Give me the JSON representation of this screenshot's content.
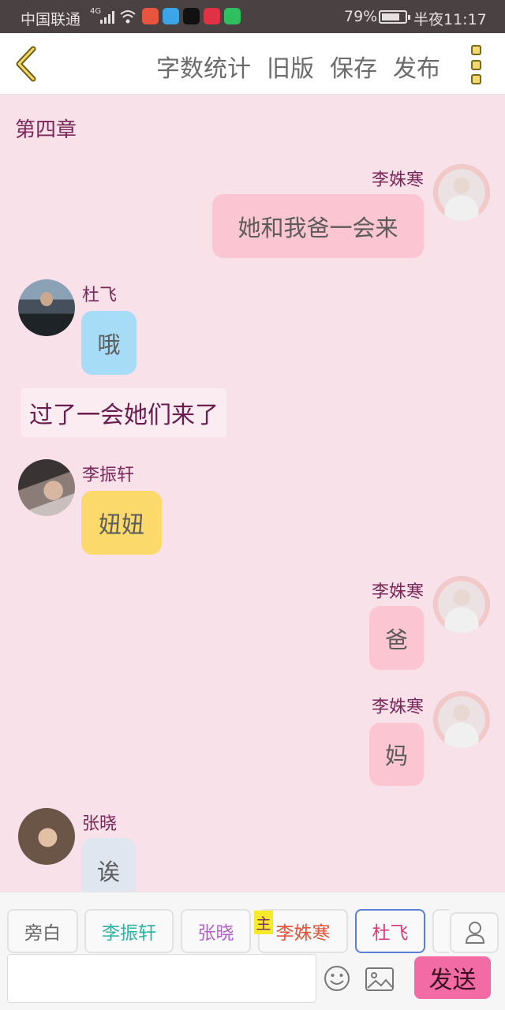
{
  "status_bar": {
    "carrier": "中国联通",
    "network_badge": "4G",
    "battery_percent": "79%",
    "time": "半夜11:17",
    "app_icon_colors": [
      "#e8553f",
      "#3ba5e8",
      "#111111",
      "#e03245",
      "#2fbf5f"
    ]
  },
  "toolbar": {
    "back_icon": "chevron-left-icon",
    "word_count": "字数统计",
    "old_version": "旧版",
    "save": "保存",
    "publish": "发布",
    "more_icon": "more-vertical-icon"
  },
  "chat": {
    "chapter": "第四章",
    "messages": [
      {
        "side": "right",
        "name": "李姝寒",
        "text": "她和我爸一会来",
        "bubble_color": "#fbc5d2"
      },
      {
        "side": "left",
        "name": "杜飞",
        "text": "哦",
        "bubble_color": "#a6dcf6"
      },
      {
        "side": "narration",
        "text": "过了一会她们来了"
      },
      {
        "side": "left",
        "name": "李振轩",
        "text": "妞妞",
        "bubble_color": "#fbd96b"
      },
      {
        "side": "right",
        "name": "李姝寒",
        "text": "爸",
        "bubble_color": "#fbc5d2"
      },
      {
        "side": "right",
        "name": "李姝寒",
        "text": "妈",
        "bubble_color": "#fbc5d2"
      },
      {
        "side": "left",
        "name": "张晓",
        "text": "诶",
        "bubble_color": "#dfe6ef"
      }
    ]
  },
  "composer": {
    "roles": [
      {
        "label": "旁白",
        "color": "#666666"
      },
      {
        "label": "李振轩",
        "color": "#2fb3a3"
      },
      {
        "label": "张晓",
        "color": "#b062c8"
      },
      {
        "label": "李姝寒",
        "color": "#e0533a"
      },
      {
        "label": "杜飞",
        "color": "#d83c7a"
      }
    ],
    "main_tag": "主",
    "send": "发送",
    "accent_color": "#f36ba5"
  }
}
